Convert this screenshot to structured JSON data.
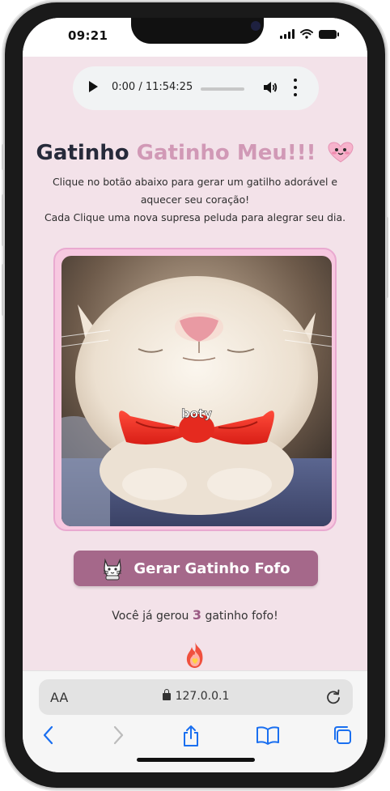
{
  "status_bar": {
    "time": "09:21"
  },
  "audio_player": {
    "time": "0:00 / 11:54:25"
  },
  "header": {
    "title_part1": "Gatinho",
    "title_part2": "Gatinho Meu!!!",
    "description_line1": "Clique no botão abaixo para gerar um gatilho adorável e aquecer seu coração!",
    "description_line2": "Cada Clique uma nova supresa peluda para alegrar seu dia."
  },
  "cat_image": {
    "caption": "boty"
  },
  "generate_button": {
    "label": "Gerar Gatinho Fofo"
  },
  "counter": {
    "prefix": "Você já gerou",
    "count": "3",
    "suffix": "gatinho fofo!"
  },
  "browser": {
    "text_size_label": "AA",
    "url": "127.0.0.1"
  },
  "colors": {
    "page_background": "#f3e2e9",
    "accent_pink": "#d199b6",
    "button": "#a5688a",
    "frame_border": "#e9a9d0",
    "ios_blue": "#1a6ff0"
  },
  "icons": [
    "play-icon",
    "volume-icon",
    "more-vert-icon",
    "heart-face-icon",
    "cat-icon",
    "fire-heart-icon",
    "lock-icon",
    "reload-icon",
    "back-icon",
    "forward-icon",
    "share-icon",
    "bookmarks-icon",
    "tabs-icon"
  ]
}
